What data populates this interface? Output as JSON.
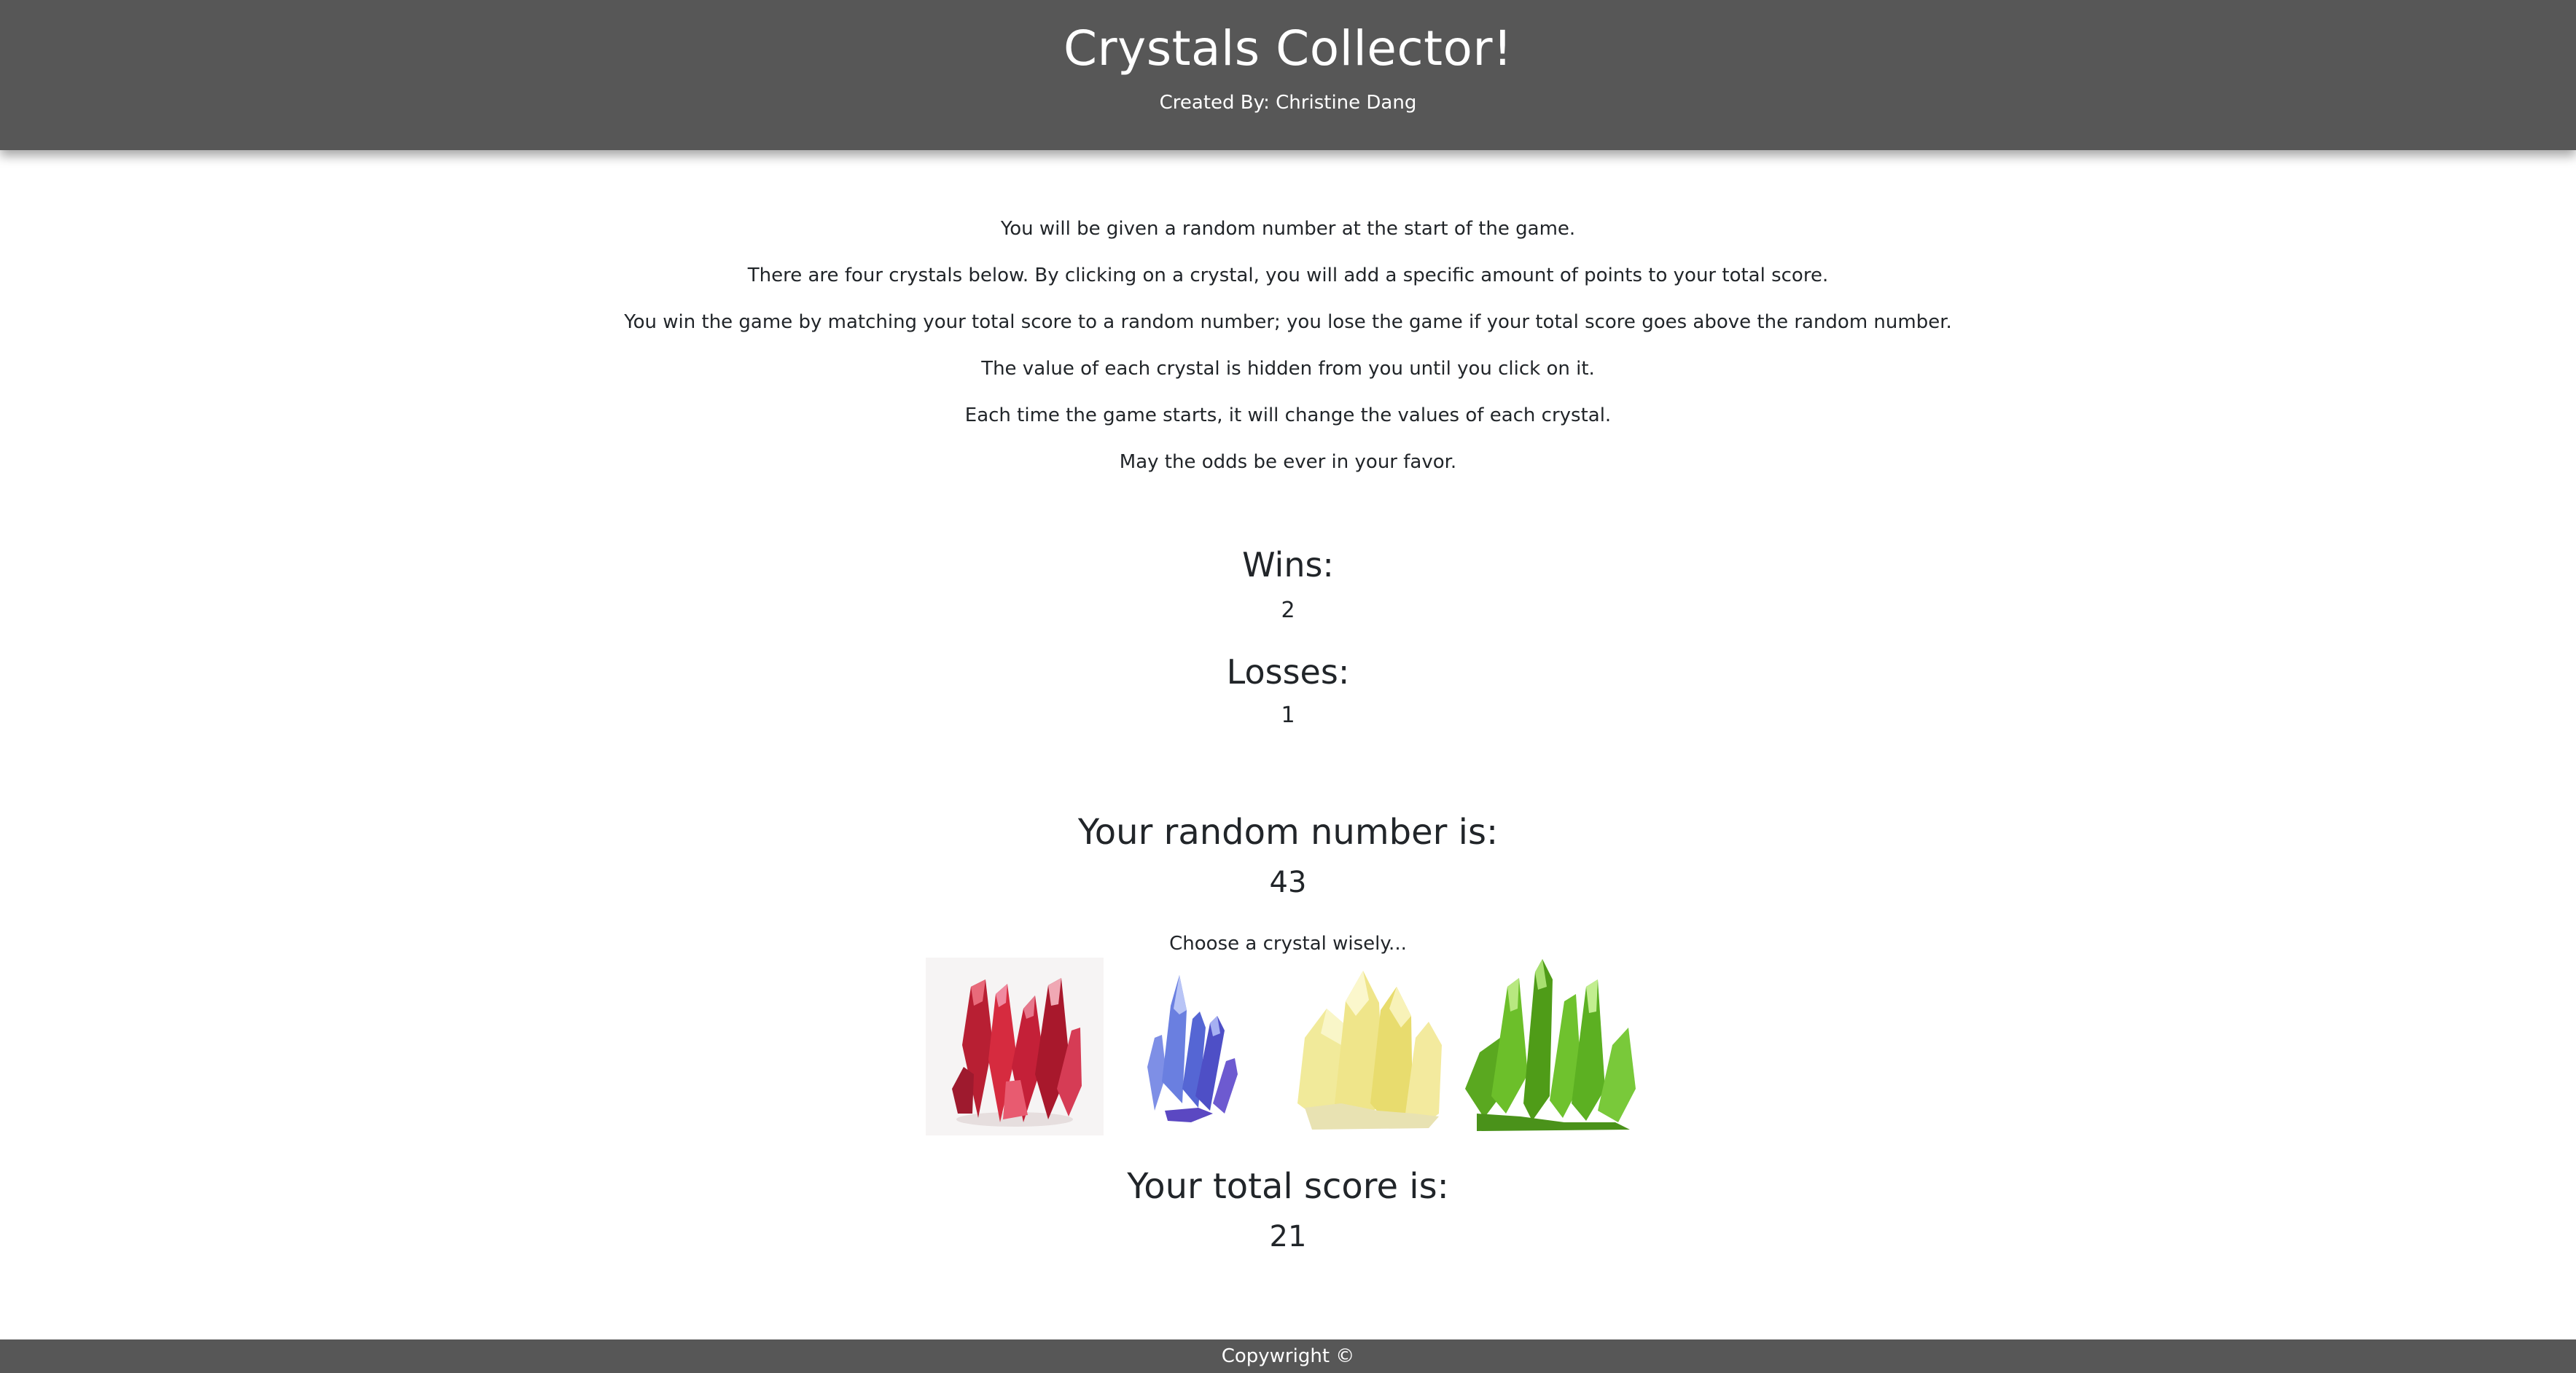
{
  "header": {
    "title": "Crystals Collector!",
    "credit": "Created By: Christine Dang"
  },
  "instructions": [
    "You will be given a random number at the start of the game.",
    "There are four crystals below. By clicking on a crystal, you will add a specific amount of points to your total score.",
    "You win the game by matching your total score to a random number; you lose the game if your total score goes above the random number.",
    "The value of each crystal is hidden from you until you click on it.",
    "Each time the game starts, it will change the values of each crystal.",
    "May the odds be ever in your favor."
  ],
  "stats": {
    "wins_label": "Wins:",
    "wins_value": "2",
    "losses_label": "Losses:",
    "losses_value": "1"
  },
  "game": {
    "random_label": "Your random number is:",
    "random_value": "43",
    "choose_label": "Choose a crystal wisely...",
    "total_label": "Your total score is:",
    "total_value": "21"
  },
  "crystals": [
    {
      "name": "red-crystal",
      "color": "#d62b3f"
    },
    {
      "name": "blue-crystal",
      "color": "#6a7fe0"
    },
    {
      "name": "yellow-crystal",
      "color": "#efe58a"
    },
    {
      "name": "green-crystal",
      "color": "#6cbf2a"
    }
  ],
  "footer": {
    "copyright": "Copywright ©"
  },
  "colors": {
    "bar": "#575757",
    "text": "#212529"
  }
}
